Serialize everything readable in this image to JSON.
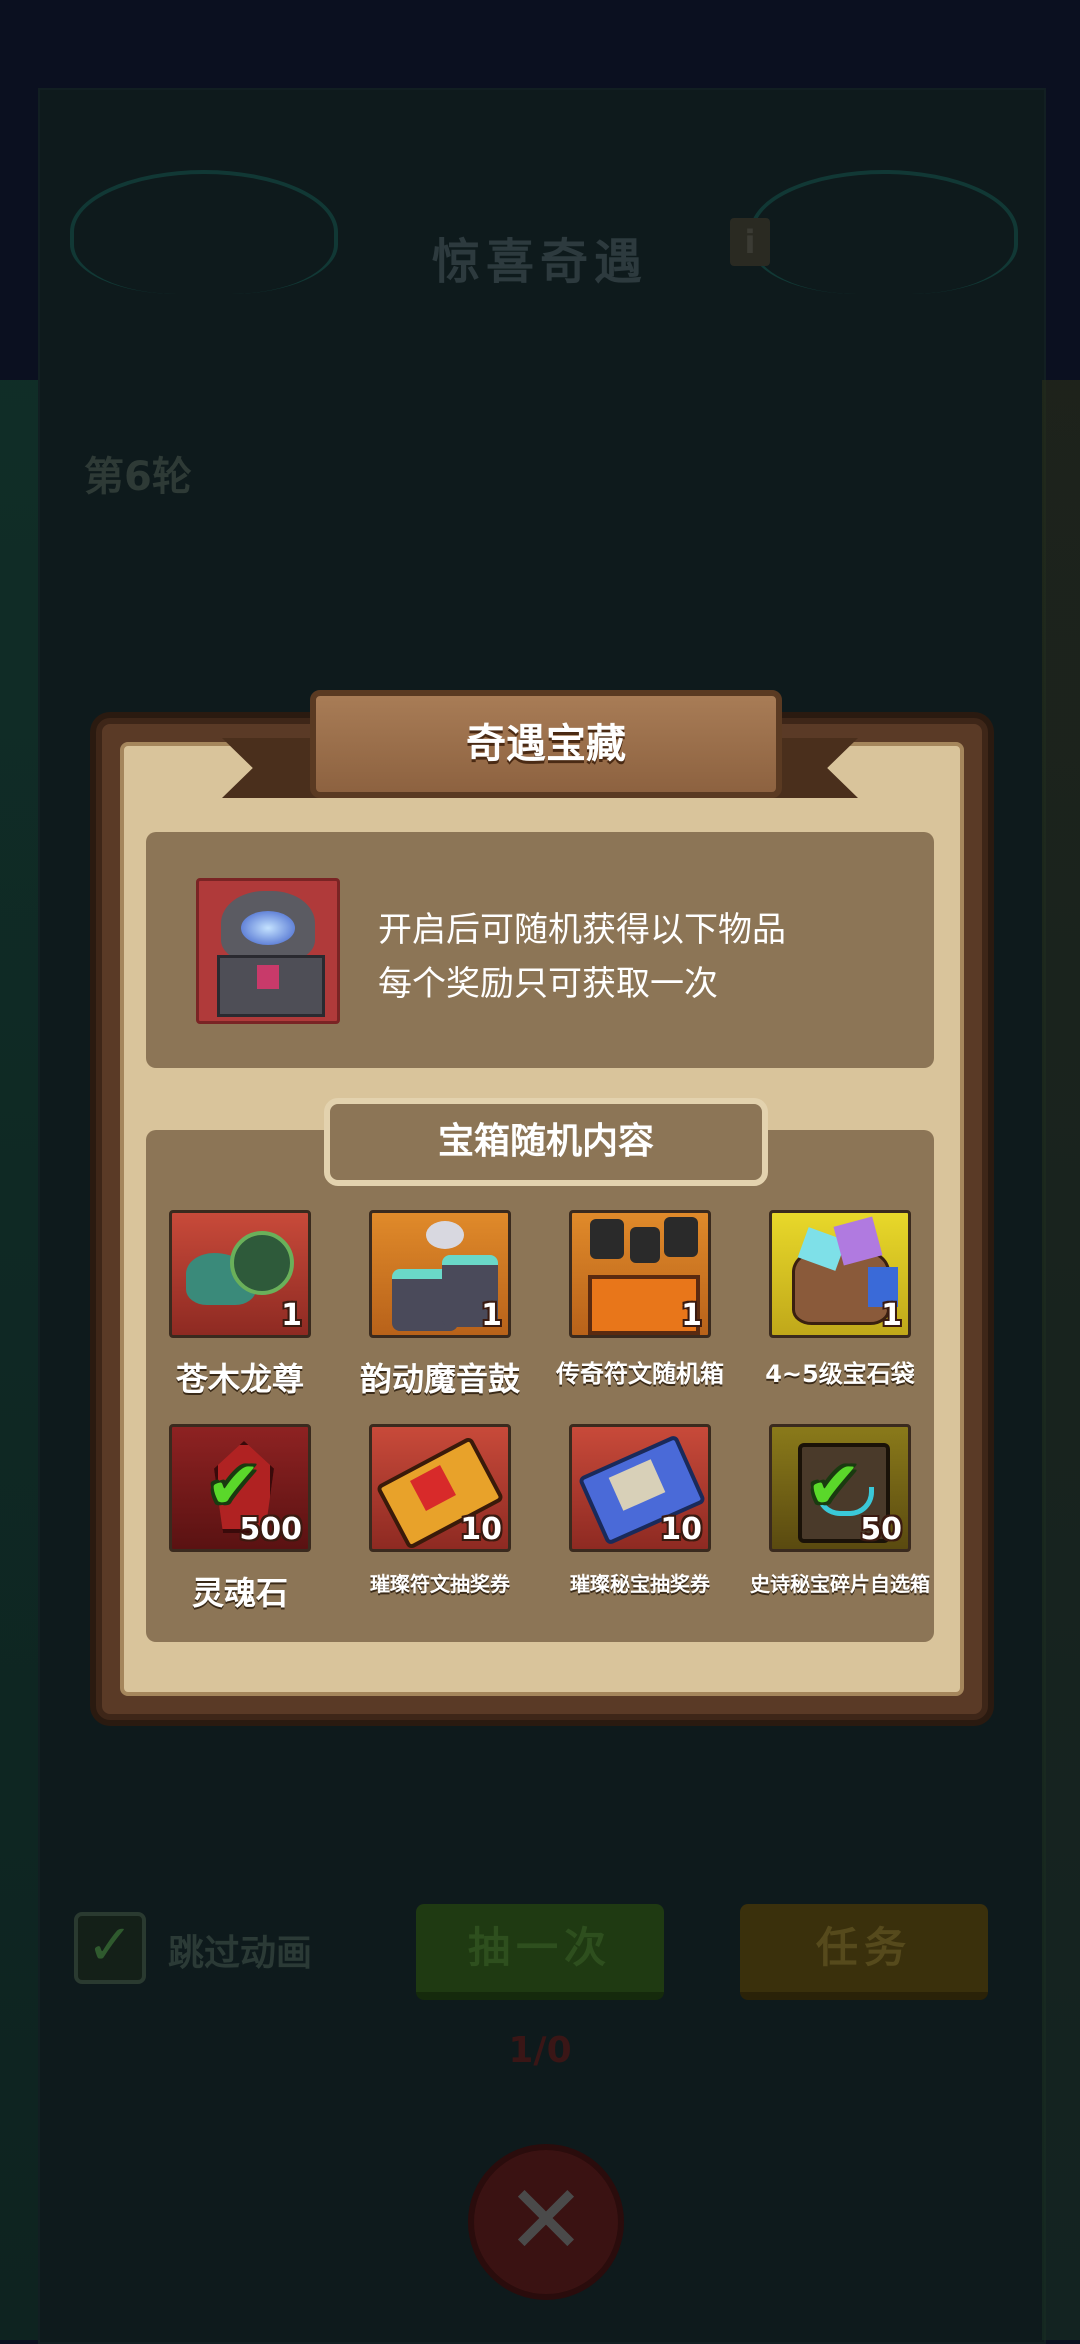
{
  "background": {
    "title": "惊喜奇遇",
    "info_icon": "info-icon",
    "round": "第6轮",
    "skip_animation": {
      "label": "跳过动画",
      "checked": true
    },
    "draw_button": "抽一次",
    "task_button": "任务",
    "counter": "1/0",
    "close_icon": "close-icon"
  },
  "modal": {
    "title": "奇遇宝藏",
    "chest_icon": "mystic-chest-icon",
    "description_line1": "开启后可随机获得以下物品",
    "description_line2": "每个奖励只可获取一次",
    "contents_title": "宝箱随机内容",
    "rewards": [
      {
        "name": "苍木龙尊",
        "count": "1",
        "icon": "dragon-icon",
        "claimed": false
      },
      {
        "name": "韵动魔音鼓",
        "count": "1",
        "icon": "drum-icon",
        "claimed": false
      },
      {
        "name": "传奇符文随机箱",
        "count": "1",
        "icon": "rune-box-icon",
        "claimed": false
      },
      {
        "name": "4~5级宝石袋",
        "count": "1",
        "icon": "gem-bag-icon",
        "claimed": false
      },
      {
        "name": "灵魂石",
        "count": "500",
        "icon": "soul-stone-icon",
        "claimed": true
      },
      {
        "name": "璀璨符文抽奖券",
        "count": "10",
        "icon": "rune-ticket-icon",
        "claimed": false
      },
      {
        "name": "璀璨秘宝抽奖券",
        "count": "10",
        "icon": "treasure-ticket-icon",
        "claimed": false
      },
      {
        "name": "史诗秘宝碎片自选箱",
        "count": "50",
        "icon": "epic-fragment-box-icon",
        "claimed": true
      }
    ]
  },
  "colors": {
    "panel_bg": "#d9c49b",
    "panel_border": "#5a3a26",
    "section_bg": "#8c7556",
    "claimed_check": "#5ad82a"
  }
}
